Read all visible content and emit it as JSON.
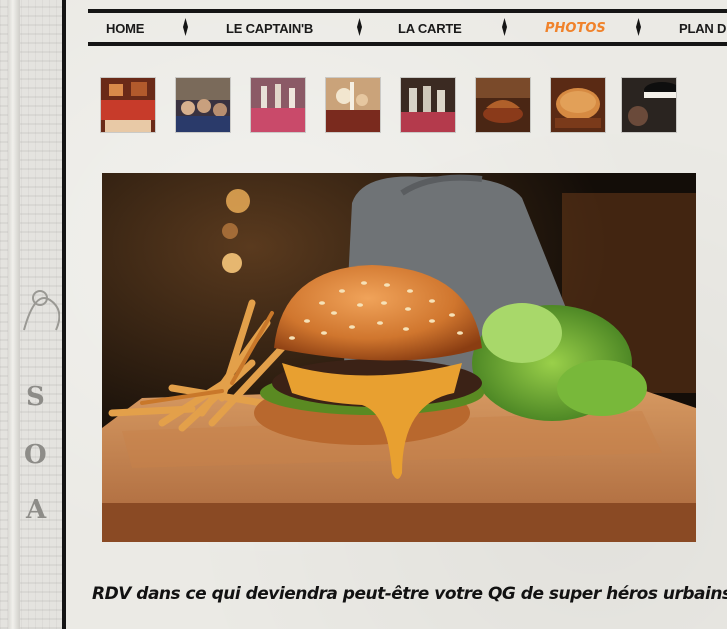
{
  "nav": {
    "items": [
      {
        "label": "HOME",
        "active": false
      },
      {
        "label": "LE CAPTAIN'B",
        "active": false
      },
      {
        "label": "LA CARTE",
        "active": false
      },
      {
        "label": "PHOTOS",
        "active": true
      },
      {
        "label": "PLAN D",
        "active": false
      }
    ],
    "accent_color": "#f0822a"
  },
  "gallery": {
    "thumbnails": [
      {
        "subject": "red dining booth"
      },
      {
        "subject": "crowd of guests"
      },
      {
        "subject": "table with glasses"
      },
      {
        "subject": "table with flowers"
      },
      {
        "subject": "wine glasses on table"
      },
      {
        "subject": "dessert dish"
      },
      {
        "subject": "sesame burger"
      },
      {
        "subject": "black lamp"
      }
    ],
    "main_photo": {
      "subject": "burger with fries and salad on a wooden board"
    }
  },
  "caption": "RDV dans ce qui deviendra peut-être votre QG de super héros urbains !"
}
